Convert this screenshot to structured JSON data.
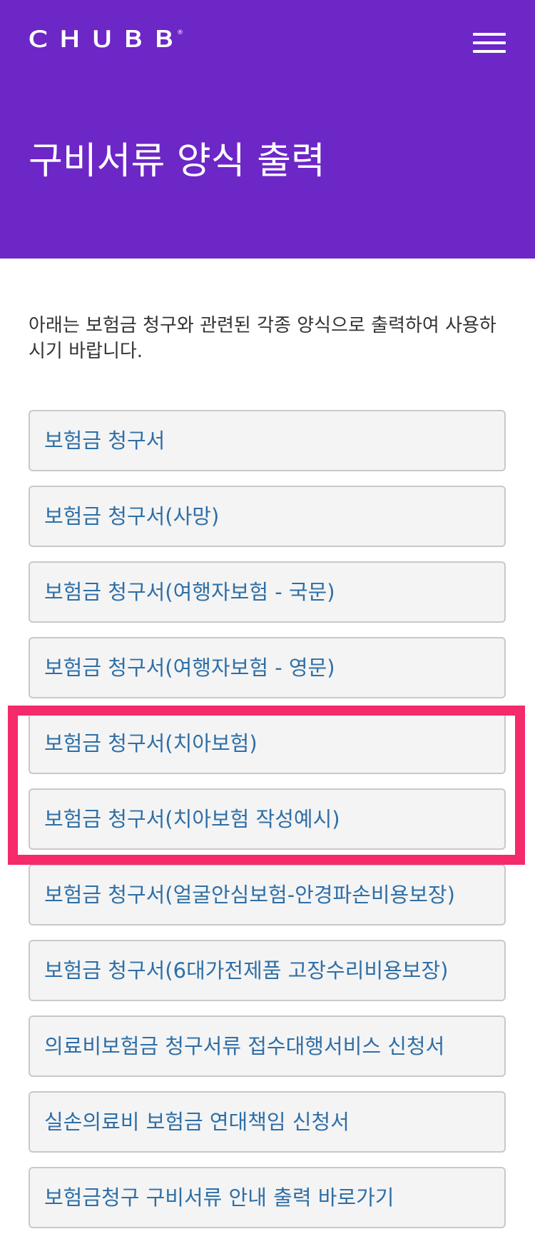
{
  "header": {
    "logo_text": "CHUBB",
    "logo_mark": "®",
    "menu_icon": "hamburger-menu-icon",
    "title": "구비서류 양식 출력",
    "background_color": "#6c27c6"
  },
  "intro": {
    "text": "아래는 보험금 청구와 관련된 각종 양식으로 출력하여 사용하시기 바랍니다."
  },
  "forms": [
    {
      "label": "보험금 청구서"
    },
    {
      "label": "보험금 청구서(사망)"
    },
    {
      "label": "보험금 청구서(여행자보험 - 국문)"
    },
    {
      "label": "보험금 청구서(여행자보험 - 영문)"
    },
    {
      "label": "보험금 청구서(치아보험)"
    },
    {
      "label": "보험금 청구서(치아보험 작성예시)"
    },
    {
      "label": "보험금 청구서(얼굴안심보험-안경파손비용보장)"
    },
    {
      "label": "보험금 청구서(6대가전제품 고장수리비용보장)"
    },
    {
      "label": "의료비보험금 청구서류 접수대행서비스 신청서"
    },
    {
      "label": "실손의료비 보험금 연대책임 신청서"
    },
    {
      "label": "보험금청구 구비서류 안내 출력 바로가기"
    }
  ],
  "colors": {
    "link_text": "#2f6fa6",
    "item_background": "#f4f4f4",
    "item_border": "#c9c9c9",
    "highlight": "#f52a6a"
  }
}
